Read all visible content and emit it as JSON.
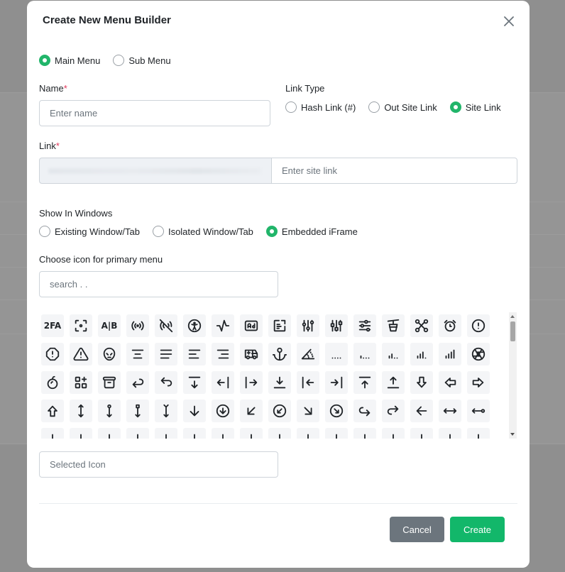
{
  "modal": {
    "title": "Create New Menu Builder",
    "close_icon": "close-icon"
  },
  "menu_type": {
    "options": [
      {
        "label": "Main Menu",
        "checked": true
      },
      {
        "label": "Sub Menu",
        "checked": false
      }
    ]
  },
  "name_field": {
    "label": "Name",
    "required_mark": "*",
    "placeholder": "Enter name"
  },
  "link_type": {
    "label": "Link Type",
    "options": [
      {
        "label": "Hash Link (#)",
        "checked": false
      },
      {
        "label": "Out Site Link",
        "checked": false
      },
      {
        "label": "Site Link",
        "checked": true
      }
    ]
  },
  "link_field": {
    "label": "Link",
    "required_mark": "*",
    "placeholder": "Enter site link"
  },
  "show_in_windows": {
    "label": "Show In Windows",
    "options": [
      {
        "label": "Existing Window/Tab",
        "checked": false
      },
      {
        "label": "Isolated Window/Tab",
        "checked": false
      },
      {
        "label": "Embedded iFrame",
        "checked": true
      }
    ]
  },
  "icon_picker": {
    "label": "Choose icon for primary menu",
    "search_placeholder": "search . .",
    "icons": [
      "2fa-icon",
      "focus-icon",
      "ab-testing-icon",
      "broadcast-icon",
      "broadcast-off-icon",
      "accessible-icon",
      "activity-icon",
      "ad-icon",
      "ad-2-icon",
      "adjustments-icon",
      "adjustments-alt-icon",
      "adjustments-horizontal-icon",
      "aerial-lift-icon",
      "affiliate-icon",
      "alarm-icon",
      "alert-circle-icon",
      "alert-octagon-icon",
      "alert-triangle-icon",
      "alien-icon",
      "align-center-icon",
      "align-justified-icon",
      "align-left-icon",
      "align-right-icon",
      "ambulance-icon",
      "anchor-icon",
      "angle-icon",
      "antenna-bars-1-icon",
      "antenna-bars-2-icon",
      "antenna-bars-3-icon",
      "antenna-bars-4-icon",
      "antenna-bars-5-icon",
      "aperture-icon",
      "apple-icon",
      "apps-icon",
      "archive-icon",
      "arrow-back-icon",
      "arrow-back-up-icon",
      "arrow-bar-down-icon",
      "arrow-bar-left-icon",
      "arrow-bar-right-icon",
      "arrow-bar-to-down-icon",
      "arrow-bar-to-left-icon",
      "arrow-bar-to-right-icon",
      "arrow-bar-to-up-icon",
      "arrow-bar-up-icon",
      "arrow-big-down-icon",
      "arrow-big-left-icon",
      "arrow-big-right-icon",
      "arrow-big-top-icon",
      "arrow-bottom-bar-icon",
      "arrow-bottom-circle-icon",
      "arrow-bottom-square-icon",
      "arrow-bottom-tail-icon",
      "arrow-down-icon",
      "arrow-down-circle-icon",
      "arrow-down-left-icon",
      "arrow-down-left-circle-icon",
      "arrow-down-right-icon",
      "arrow-down-right-circle-icon",
      "arrow-forward-icon",
      "arrow-forward-up-icon",
      "arrow-left-icon",
      "arrow-left-bar-icon",
      "arrow-left-circle-icon",
      "arrow-left-square-icon",
      "arrow-left-tail-icon",
      "arrow-loop-left-icon",
      "arrow-loop-right-icon",
      "arrow-narrow-down-icon",
      "arrow-narrow-left-icon",
      "arrow-narrow-right-icon",
      "arrow-narrow-up-icon",
      "arrow-ramp-left-icon",
      "arrow-ramp-right-icon",
      "arrow-right-icon",
      "arrow-right-bar-icon",
      "arrow-right-circle-icon",
      "arrow-right-square-icon",
      "arrow-right-tail-icon",
      "arrow-top-bar-icon"
    ]
  },
  "selected_icon_field": {
    "placeholder": "Selected Icon"
  },
  "footer": {
    "cancel_label": "Cancel",
    "create_label": "Create"
  },
  "colors": {
    "accent": "#12b76a",
    "cancel": "#6c757d",
    "required": "#e0365a"
  }
}
